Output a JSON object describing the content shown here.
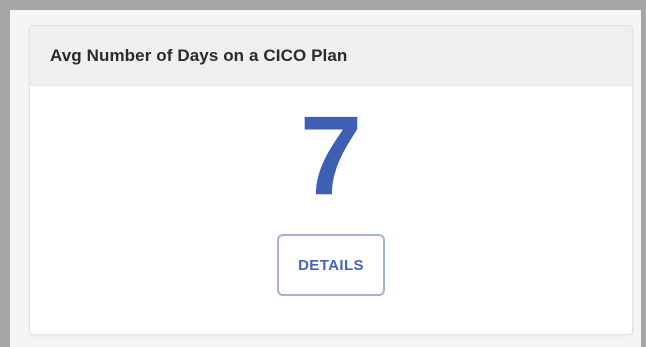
{
  "widget": {
    "title": "Avg Number of Days on a CICO Plan",
    "value": "7",
    "details_label": "DETAILS"
  },
  "colors": {
    "accent": "#3e5fb3",
    "header_bg": "#efefef",
    "frame": "#a7a5a6"
  }
}
